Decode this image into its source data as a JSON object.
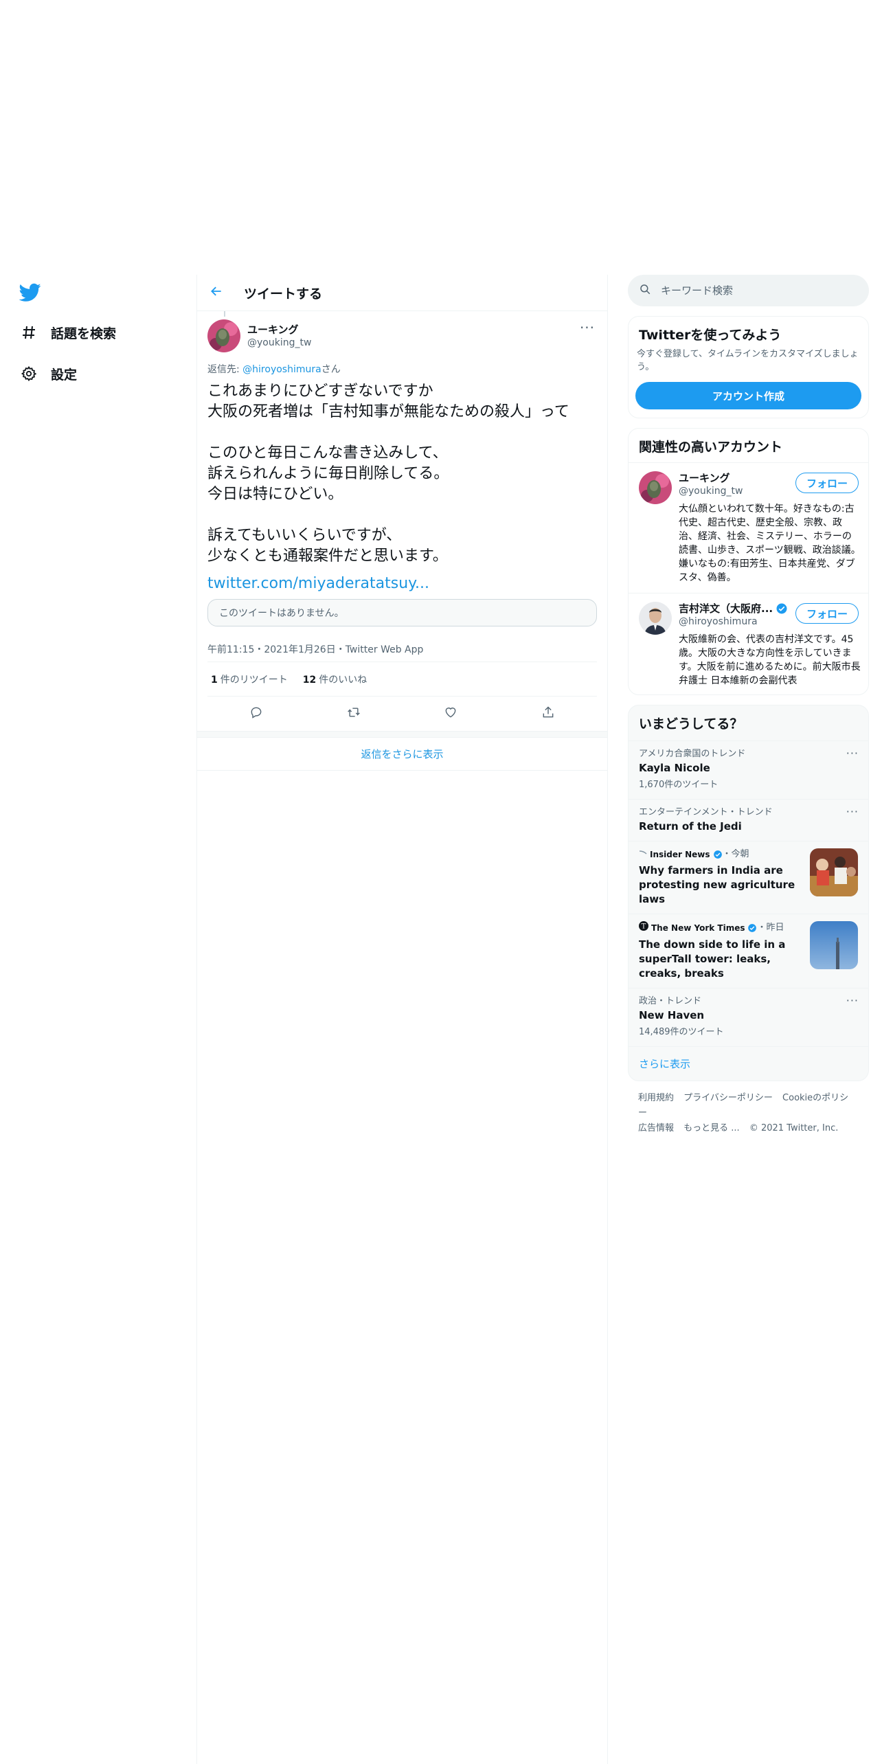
{
  "nav": {
    "items": [
      {
        "label": "話題を検索",
        "icon": "hashtag-icon"
      },
      {
        "label": "設定",
        "icon": "gear-icon"
      }
    ]
  },
  "header": {
    "title": "ツイートする"
  },
  "tweet": {
    "display_name": "ユーキング",
    "handle": "@youking_tw",
    "reply_prefix": "返信先: ",
    "reply_to": "@hiroyoshimura",
    "reply_suffix": "さん",
    "text": "これあまりにひどすぎないですか\n大阪の死者増は「吉村知事が無能なための殺人」って\n\nこのひと毎日こんな書き込みして、\n訴えられんように毎日削除してる。\n今日は特にひどい。\n\n訴えてもいいくらいですが、\n少なくとも通報案件だと思います。",
    "link": "twitter.com/miyaderatatsuy...",
    "quote_unavailable": "このツイートはありません。",
    "meta": "午前11:15・2021年1月26日・Twitter Web App",
    "retweet_count": "1",
    "retweet_label": "件のリツイート",
    "like_count": "12",
    "like_label": "件のいいね",
    "show_more_replies": "返信をさらに表示"
  },
  "sidebar": {
    "search_placeholder": "キーワード検索",
    "signup": {
      "title": "Twitterを使ってみよう",
      "desc": "今すぐ登録して、タイムラインをカスタマイズしましょう。",
      "button": "アカウント作成"
    },
    "related": {
      "title": "関連性の高いアカウント",
      "follow_label": "フォロー",
      "accounts": [
        {
          "name": "ユーキング",
          "handle": "@youking_tw",
          "bio": "大仏顔といわれて数十年。好きなもの:古代史、超古代史、歴史全般、宗教、政治、経済、社会、ミステリー、ホラーの読書、山歩き、スポーツ観戦、政治談議。嫌いなもの:有田芳生、日本共産党、ダブスタ、偽善。"
        },
        {
          "name": "吉村洋文（大阪府...",
          "handle": "@hiroyoshimura",
          "bio": "大阪維新の会、代表の吉村洋文です。45歳。大阪の大きな方向性を示していきます。大阪を前に進めるために。前大阪市長 弁護士 日本維新の会副代表"
        }
      ]
    },
    "trends": {
      "title": "いまどうしてる？",
      "items": [
        {
          "context": "アメリカ合衆国のトレンド",
          "name": "Kayla Nicole",
          "count": "1,670件のツイート"
        },
        {
          "context": "エンターテインメント・トレンド",
          "name": "Return of the Jedi"
        },
        {
          "source": "Insider News",
          "time": "・今朝",
          "headline": "Why farmers in India are protesting new agriculture laws"
        },
        {
          "source": "The New York Times",
          "time": "・昨日",
          "headline": "The down side to life in a superTall tower: leaks, creaks, breaks"
        },
        {
          "context": "政治・トレンド",
          "name": "New Haven",
          "count": "14,489件のツイート"
        }
      ],
      "show_more": "さらに表示"
    },
    "footer": {
      "links": [
        "利用規約",
        "プライバシーポリシー",
        "Cookieのポリシー",
        "広告情報",
        "もっと見る ...",
        "© 2021 Twitter, Inc."
      ]
    }
  },
  "colors": {
    "accent": "#1d9bf0",
    "text": "#0f1419",
    "muted": "#536471",
    "border": "#eff3f4"
  }
}
